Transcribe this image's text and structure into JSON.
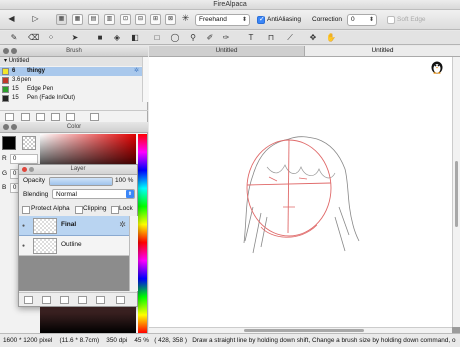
{
  "window": {
    "title": "FireAlpaca"
  },
  "toolbar": {
    "brush_mode": "Freehand",
    "antialiasing": {
      "label": "AntiAliasing",
      "checked": true
    },
    "correction": {
      "label": "Correction",
      "value": "0"
    },
    "soft_edge": {
      "label": "Soft Edge",
      "checked": false
    }
  },
  "tabs": [
    {
      "label": "Untitled",
      "active": false
    },
    {
      "label": "Untitled",
      "active": true
    }
  ],
  "brush_panel": {
    "title": "Brush",
    "group": "Untitled",
    "items": [
      {
        "size": "6",
        "name": "thingy",
        "color": "#f2e62a",
        "selected": true
      },
      {
        "size": "3.6",
        "name": "pen",
        "color": "#c0392b",
        "selected": false
      },
      {
        "size": "15",
        "name": "Edge Pen",
        "color": "#2ca02c",
        "selected": false
      },
      {
        "size": "15",
        "name": "Pen (Fade In/Out)",
        "color": "#222222",
        "selected": false
      }
    ]
  },
  "color_panel": {
    "title": "Color",
    "r_label": "R",
    "r_value": "0",
    "g_label": "G",
    "g_value": "0",
    "b_label": "B",
    "b_value": "0",
    "primary_color": "#000000",
    "hue_color": "#e00000"
  },
  "layer_panel": {
    "title": "Layer",
    "opacity_label": "Opacity",
    "opacity_value": "100 %",
    "opacity_fraction": 1.0,
    "blending_label": "Blending",
    "blending_value": "Normal",
    "protect_alpha": "Protect Alpha",
    "clipping": "Clipping",
    "lock": "Lock",
    "layers": [
      {
        "name": "Final",
        "selected": true
      },
      {
        "name": "Outline",
        "selected": false
      }
    ]
  },
  "status": {
    "dimensions": "1600 * 1200 pixel",
    "physical": "(11.6 * 8.7cm)",
    "dpi": "350 dpi",
    "zoom": "45 %",
    "coords": "( 428, 358 )",
    "hint": "Draw a straight line by holding down shift, Change a brush size by holding down command, o"
  }
}
